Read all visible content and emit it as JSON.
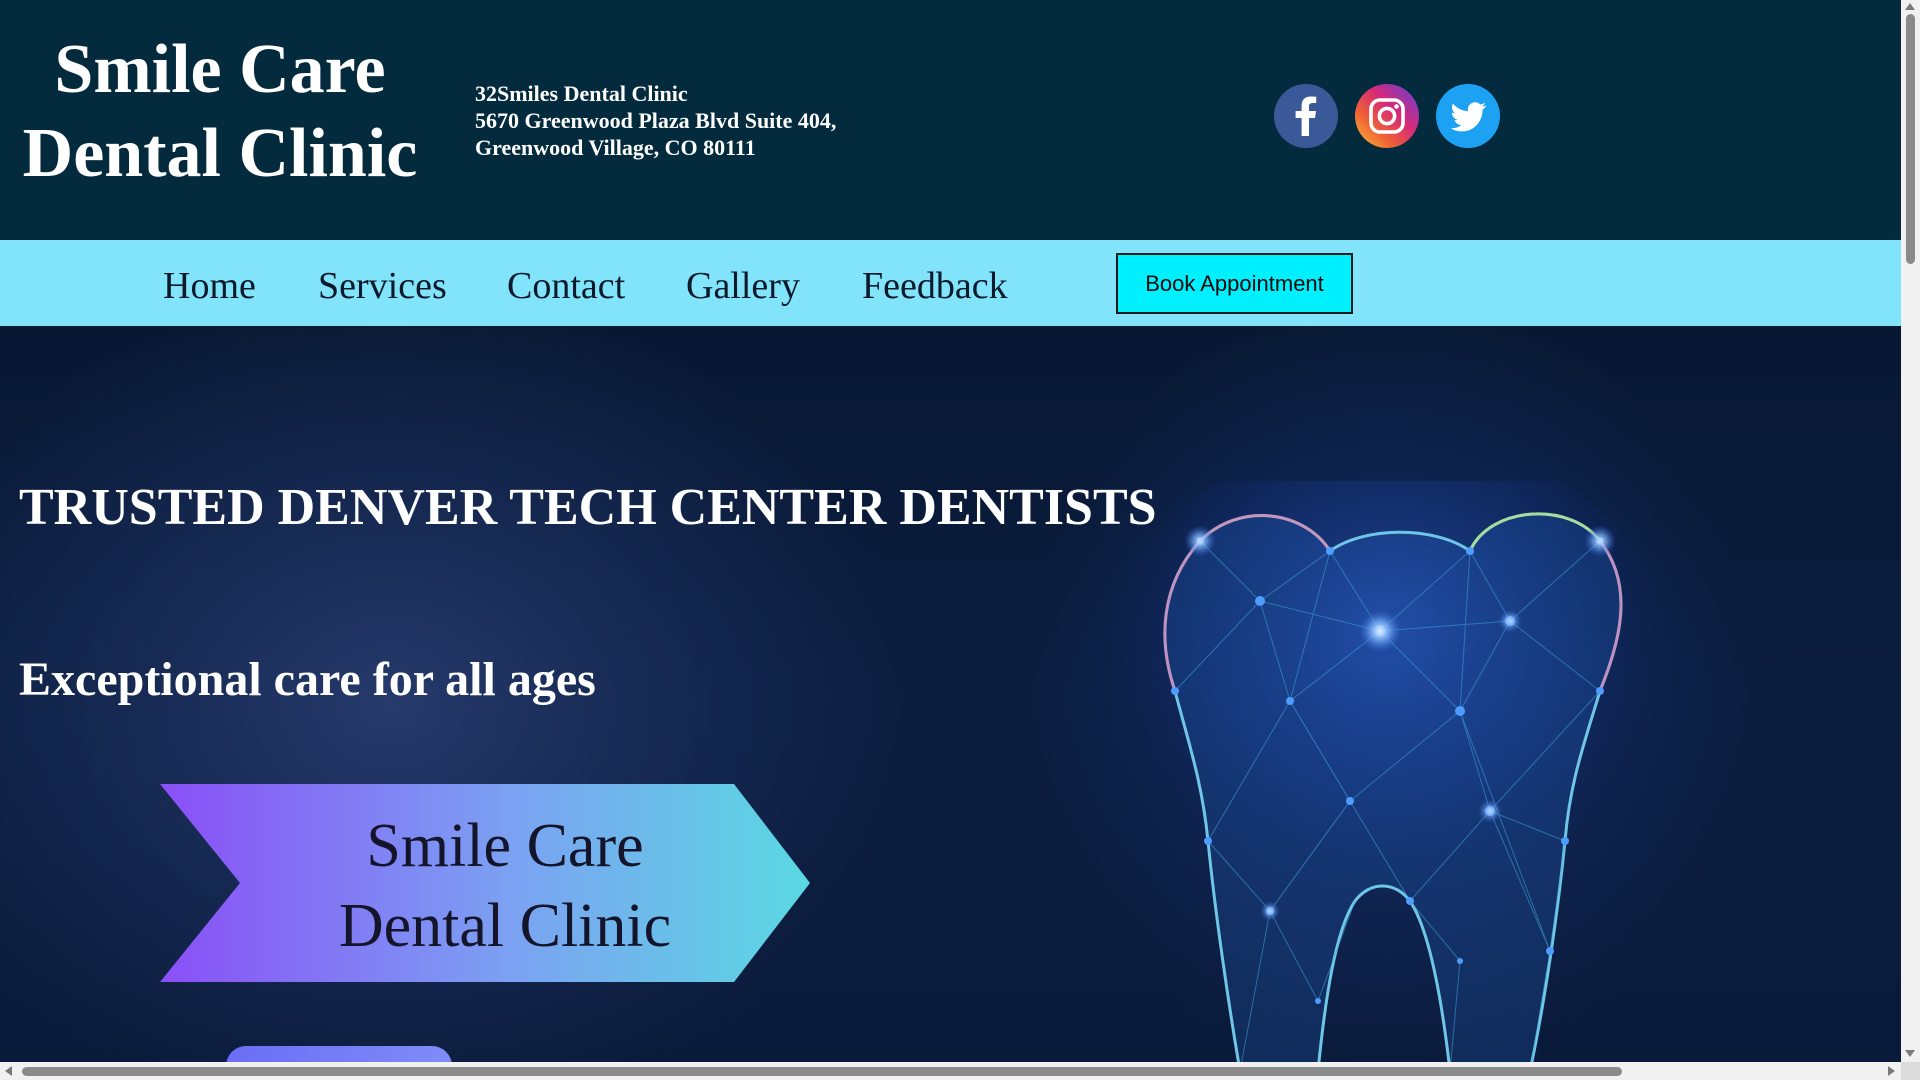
{
  "header": {
    "brand_line1": "Smile Care",
    "brand_line2": "Dental Clinic",
    "address_line1": "32Smiles Dental Clinic",
    "address_line2": "5670 Greenwood Plaza Blvd Suite 404,",
    "address_line3": "Greenwood Village, CO 80111",
    "social_icons": [
      "facebook-icon",
      "instagram-icon",
      "twitter-icon"
    ]
  },
  "nav": {
    "items": [
      {
        "label": "Home"
      },
      {
        "label": "Services"
      },
      {
        "label": "Contact"
      },
      {
        "label": "Gallery"
      },
      {
        "label": "Feedback"
      }
    ],
    "book_label": "Book Appointment"
  },
  "hero": {
    "title": "TRUSTED DENVER TECH CENTER DENTISTS",
    "subtitle": "Exceptional care for all ages",
    "banner_line1": "Smile Care",
    "banner_line2": "Dental Clinic"
  },
  "colors": {
    "header_bg": "#042a3d",
    "nav_bg": "#82e4fb",
    "button_bg": "#00f0ff",
    "hero_bg": "#0a1a3a"
  }
}
